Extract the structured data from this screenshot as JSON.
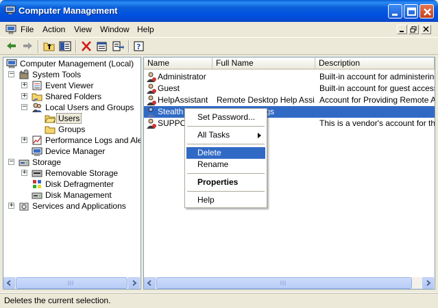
{
  "window": {
    "title": "Computer Management"
  },
  "menubar": {
    "items": [
      "File",
      "Action",
      "View",
      "Window",
      "Help"
    ]
  },
  "toolbar": {
    "icons": [
      "back-icon",
      "forward-icon",
      "up-folder-icon",
      "show-tree-icon",
      "delete-icon",
      "properties-icon",
      "export-icon",
      "help-icon"
    ]
  },
  "tree": {
    "root": "Computer Management (Local)",
    "system_tools": "System Tools",
    "event_viewer": "Event Viewer",
    "shared_folders": "Shared Folders",
    "local_users_groups": "Local Users and Groups",
    "users": "Users",
    "groups": "Groups",
    "perf_logs": "Performance Logs and Alerts",
    "device_manager": "Device Manager",
    "storage": "Storage",
    "removable_storage": "Removable Storage",
    "disk_defrag": "Disk Defragmenter",
    "disk_mgmt": "Disk Management",
    "services_apps": "Services and Applications"
  },
  "list": {
    "headers": {
      "name": "Name",
      "full_name": "Full Name",
      "description": "Description"
    },
    "rows": [
      {
        "name": "Administrator",
        "full_name": "",
        "description": "Built-in account for administering th"
      },
      {
        "name": "Guest",
        "full_name": "",
        "description": "Built-in account for guest access to"
      },
      {
        "name": "HelpAssistant",
        "full_name": "Remote Desktop Help Assi...",
        "description": "Account for Providing Remote Assist"
      },
      {
        "name": "Stealth",
        "full_name": "Stealth Settings",
        "description": ""
      },
      {
        "name": "SUPPOR",
        "full_name": "...orporation...",
        "description": "This is a vendor's account for the H"
      }
    ]
  },
  "context_menu": {
    "set_password": "Set Password...",
    "all_tasks": "All Tasks",
    "delete": "Delete",
    "rename": "Rename",
    "properties": "Properties",
    "help": "Help"
  },
  "status": {
    "text": "Deletes the current selection."
  },
  "colors": {
    "title_blue": "#0a5fd8",
    "selection": "#316ac5",
    "chrome": "#ece9d8"
  }
}
